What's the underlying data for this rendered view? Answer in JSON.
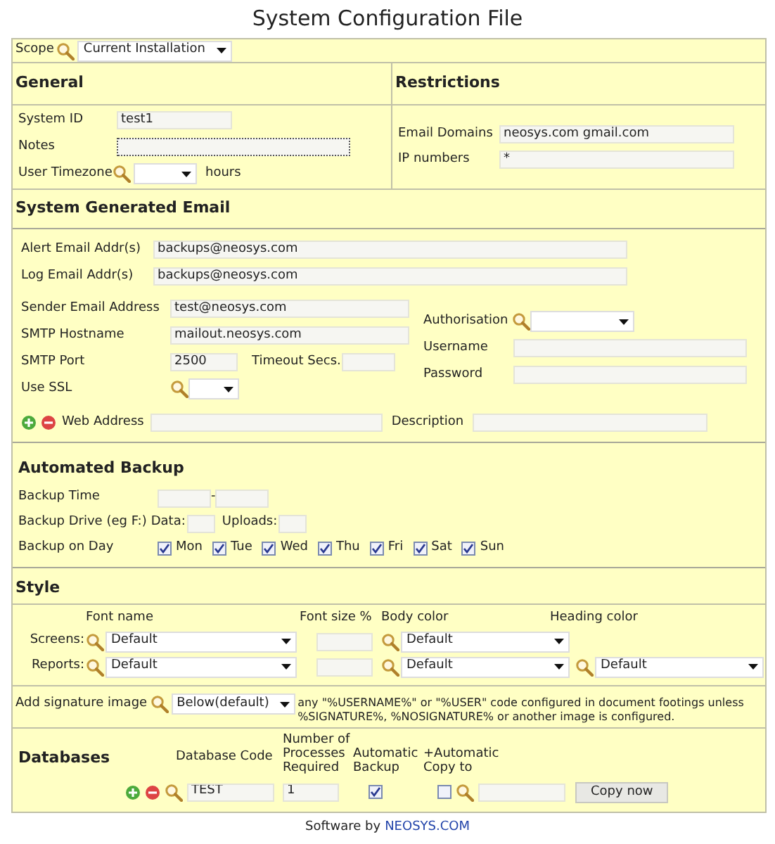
{
  "title": "System Configuration File",
  "scope": {
    "label": "Scope",
    "value": "Current Installation"
  },
  "general": {
    "heading": "General",
    "fields": [
      {
        "kind": "text",
        "label": "System ID",
        "value": "test1"
      },
      {
        "kind": "text",
        "label": "Notes",
        "focused": true
      },
      {
        "kind": "lookup",
        "label": "User Timezone",
        "suffix": "hours"
      }
    ]
  },
  "restrictions": {
    "heading": "Restrictions",
    "fields": [
      {
        "label": "Email Domains",
        "value": "neosys.com gmail.com"
      },
      {
        "label": "IP numbers",
        "value": "*"
      }
    ]
  },
  "email": {
    "heading": "System Generated Email",
    "addresses": [
      {
        "label": "Alert Email Addr(s)",
        "value": "backups@neosys.com"
      },
      {
        "label": "Log Email Addr(s)",
        "value": "backups@neosys.com"
      }
    ],
    "sender": {
      "label": "Sender Email Address",
      "value": "test@neosys.com"
    },
    "host": {
      "label": "SMTP Hostname",
      "value": "mailout.neosys.com"
    },
    "port": {
      "label": "SMTP Port",
      "value": "2500"
    },
    "timeout": {
      "label": "Timeout Secs."
    },
    "ssl": {
      "label": "Use SSL"
    },
    "auth": {
      "label": "Authorisation"
    },
    "username": {
      "label": "Username"
    },
    "password": {
      "label": "Password"
    },
    "web": {
      "label": "Web Address",
      "description_label": "Description"
    }
  },
  "backup": {
    "heading": "Automated Backup",
    "time_label": "Backup Time",
    "time_separator": "-",
    "drive_label": "Backup Drive (eg F:)",
    "data_label": "Data:",
    "uploads_label": "Uploads:",
    "day_label": "Backup on Day",
    "days": [
      {
        "label": "Mon",
        "checked": true
      },
      {
        "label": "Tue",
        "checked": true
      },
      {
        "label": "Wed",
        "checked": true
      },
      {
        "label": "Thu",
        "checked": true
      },
      {
        "label": "Fri",
        "checked": true
      },
      {
        "label": "Sat",
        "checked": true
      },
      {
        "label": "Sun",
        "checked": true
      }
    ]
  },
  "style": {
    "heading": "Style",
    "columns": [
      "Font name",
      "Font size %",
      "Body color",
      "Heading color"
    ],
    "rows": [
      {
        "label": "Screens:",
        "font": "Default",
        "body": "Default"
      },
      {
        "label": "Reports:",
        "font": "Default",
        "body": "Default",
        "heading": "Default"
      }
    ],
    "signature": {
      "label": "Add signature image",
      "value": "Below(default)",
      "note": "any \"%USERNAME%\" or \"%USER\" code configured in document footings unless %SIGNATURE%, %NOSIGNATURE% or another image is configured."
    }
  },
  "databases": {
    "heading": "Databases",
    "columns": [
      "Database Code",
      "Number of Processes Required",
      "Automatic Backup",
      "+Automatic Copy to"
    ],
    "rows": [
      {
        "code": "TEST",
        "processes": "1",
        "auto_backup": true,
        "auto_copy": false
      }
    ],
    "copy_button": "Copy now"
  },
  "footer": {
    "prefix": "Software by",
    "link": "NEOSYS.COM"
  }
}
